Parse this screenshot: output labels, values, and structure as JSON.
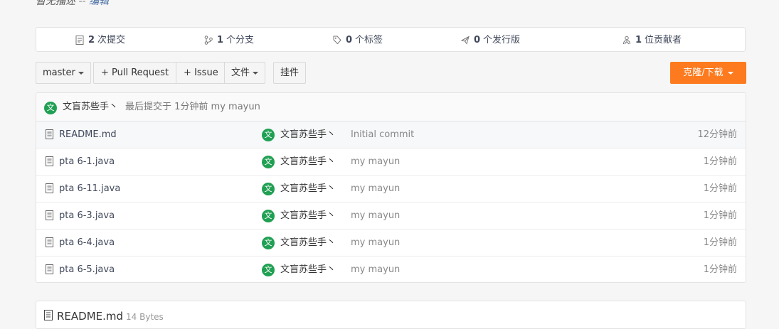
{
  "description": {
    "text": "暂无描述",
    "separator": "--",
    "edit_link": "编辑"
  },
  "stats": [
    {
      "count": "2",
      "label": "次提交",
      "icon": "commit-icon"
    },
    {
      "count": "1",
      "label": "个分支",
      "icon": "branch-icon"
    },
    {
      "count": "0",
      "label": "个标签",
      "icon": "tag-icon"
    },
    {
      "count": "0",
      "label": "个发行版",
      "icon": "release-icon"
    },
    {
      "count": "1",
      "label": "位贡献者",
      "icon": "contributors-icon"
    }
  ],
  "toolbar": {
    "branch": "master",
    "pull_request": "+ Pull Request",
    "issue": "+ Issue",
    "file_menu": "文件",
    "attachments": "挂件",
    "clone": "克隆/下载"
  },
  "latest_commit": {
    "avatar_char": "文",
    "author": "文盲苏些手丶",
    "summary": "最后提交于 1分钟前 my mayun"
  },
  "files": [
    {
      "name": "README.md",
      "avatar_char": "文",
      "author": "文盲苏些手丶",
      "message": "Initial commit",
      "time": "12分钟前"
    },
    {
      "name": "pta 6-1.java",
      "avatar_char": "文",
      "author": "文盲苏些手丶",
      "message": "my mayun",
      "time": "1分钟前"
    },
    {
      "name": "pta 6-11.java",
      "avatar_char": "文",
      "author": "文盲苏些手丶",
      "message": "my mayun",
      "time": "1分钟前"
    },
    {
      "name": "pta 6-3.java",
      "avatar_char": "文",
      "author": "文盲苏些手丶",
      "message": "my mayun",
      "time": "1分钟前"
    },
    {
      "name": "pta 6-4.java",
      "avatar_char": "文",
      "author": "文盲苏些手丶",
      "message": "my mayun",
      "time": "1分钟前"
    },
    {
      "name": "pta 6-5.java",
      "avatar_char": "文",
      "author": "文盲苏些手丶",
      "message": "my mayun",
      "time": "1分钟前"
    }
  ],
  "readme": {
    "title": "README.md",
    "size": "14 Bytes"
  },
  "colors": {
    "accent": "#fd7b1e",
    "avatar": "#20a053"
  }
}
